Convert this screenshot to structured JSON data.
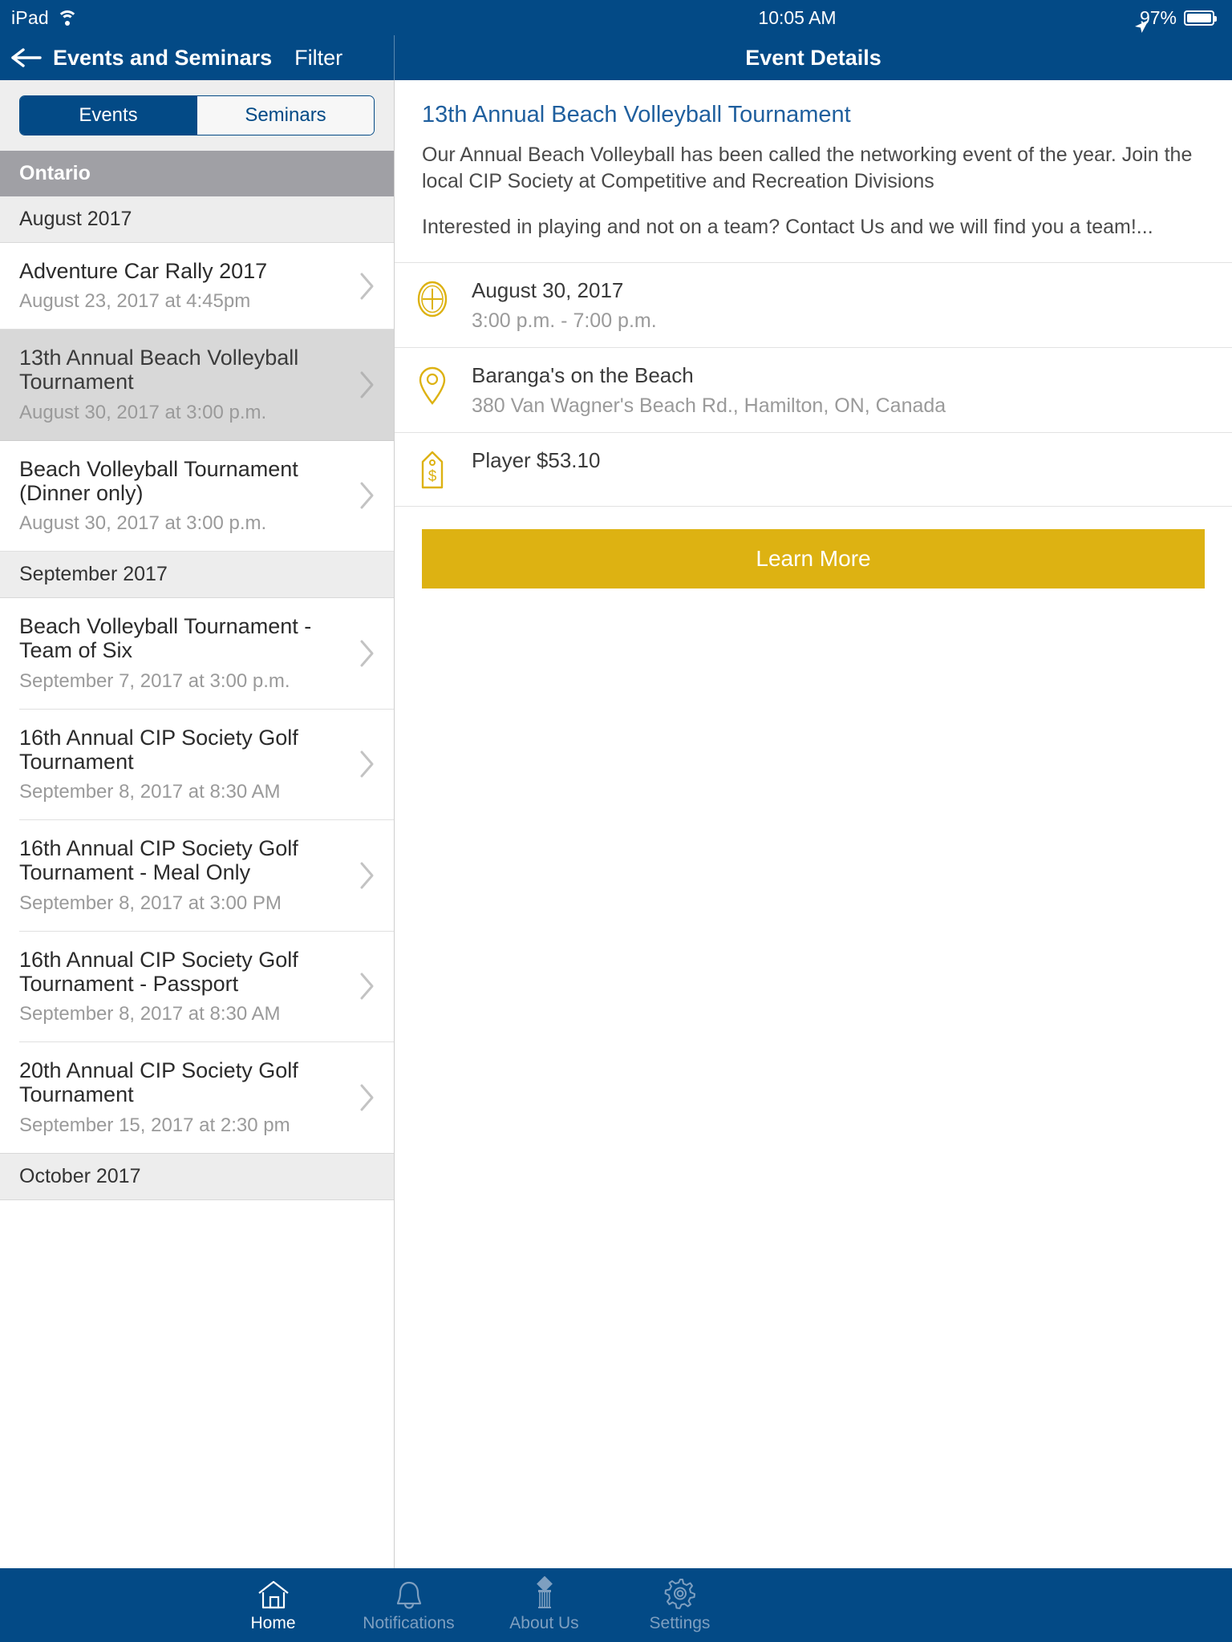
{
  "status_bar": {
    "device": "iPad",
    "wifi_icon": "wifi-icon",
    "time": "10:05 AM",
    "location_icon": "location-arrow-icon",
    "battery_percent": "97%",
    "battery_icon": "battery-icon"
  },
  "nav": {
    "back_icon": "back-arrow-icon",
    "title": "Events and Seminars",
    "filter_label": "Filter",
    "detail_title": "Event Details"
  },
  "segmented": {
    "options": [
      "Events",
      "Seminars"
    ],
    "selected": "Events"
  },
  "region_header": "Ontario",
  "sections": [
    {
      "month": "August 2017",
      "events": [
        {
          "title": "Adventure Car Rally 2017",
          "datetime": "August 23, 2017 at 4:45pm",
          "selected": false,
          "hairline": false
        },
        {
          "title": "13th Annual Beach Volleyball Tournament",
          "datetime": "August 30, 2017 at 3:00 p.m.",
          "selected": true,
          "hairline": false
        },
        {
          "title": "Beach Volleyball Tournament (Dinner only)",
          "datetime": "August 30, 2017 at 3:00 p.m.",
          "selected": false,
          "hairline": false
        }
      ]
    },
    {
      "month": "September 2017",
      "events": [
        {
          "title": "Beach Volleyball Tournament - Team of Six",
          "datetime": "September 7, 2017 at 3:00 p.m.",
          "selected": false,
          "hairline": true
        },
        {
          "title": "16th Annual CIP Society Golf Tournament",
          "datetime": "September 8, 2017 at 8:30 AM",
          "selected": false,
          "hairline": true
        },
        {
          "title": "16th Annual CIP Society Golf Tournament - Meal Only",
          "datetime": "September 8, 2017 at 3:00 PM",
          "selected": false,
          "hairline": true
        },
        {
          "title": "16th Annual CIP Society Golf Tournament - Passport",
          "datetime": "September 8, 2017 at 8:30 AM",
          "selected": false,
          "hairline": true
        },
        {
          "title": "20th Annual CIP Society Golf Tournament",
          "datetime": "September 15, 2017 at 2:30 pm",
          "selected": false,
          "hairline": true
        }
      ]
    },
    {
      "month": "October 2017",
      "events": []
    }
  ],
  "detail": {
    "title": "13th Annual Beach Volleyball Tournament",
    "description_p1": "Our Annual Beach Volleyball has been called the networking event of the year.  Join the local CIP Society at Competitive and Recreation Divisions",
    "description_p2": "Interested in playing and not on a team? Contact Us and we will find you a team!...",
    "rows": [
      {
        "icon": "clock-icon",
        "main": "August 30, 2017",
        "sub": "3:00 p.m. - 7:00 p.m."
      },
      {
        "icon": "map-pin-icon",
        "main": "Baranga's on the Beach",
        "sub": "380 Van Wagner's Beach Rd., Hamilton, ON, Canada"
      },
      {
        "icon": "price-tag-icon",
        "main": "Player $53.10",
        "sub": ""
      }
    ],
    "learn_more_label": "Learn More",
    "accent_color": "#ddb212",
    "link_color": "#1f5f9e"
  },
  "tabbar": {
    "items": [
      {
        "label": "Home",
        "icon": "home-icon",
        "active": true
      },
      {
        "label": "Notifications",
        "icon": "bell-icon",
        "active": false
      },
      {
        "label": "About Us",
        "icon": "pillar-icon",
        "active": false
      },
      {
        "label": "Settings",
        "icon": "gear-icon",
        "active": false
      }
    ]
  },
  "colors": {
    "nav_blue": "#034a86",
    "region_gray": "#a0a0a5",
    "gold": "#ddb212"
  }
}
